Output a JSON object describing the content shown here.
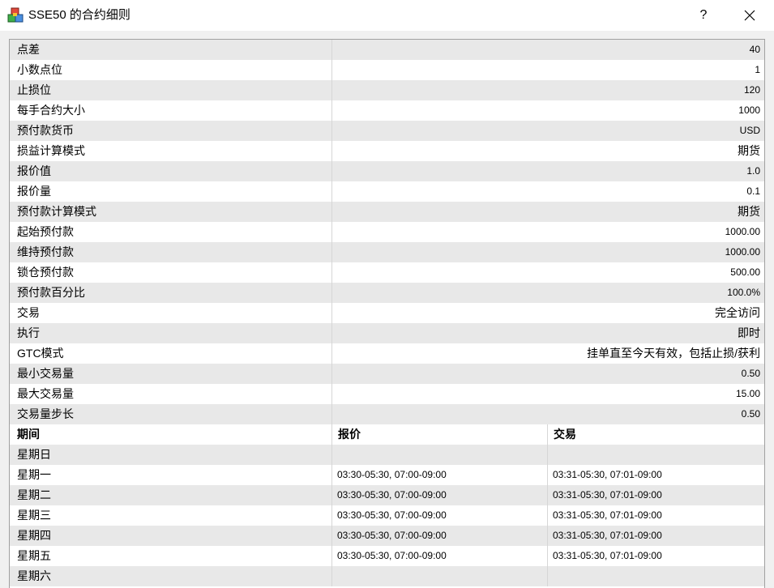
{
  "window": {
    "title": "SSE50 的合约细则",
    "help_label": "?",
    "icons": {
      "app": "app-cubes-icon",
      "close": "close-icon"
    }
  },
  "specs": [
    {
      "label": "点差",
      "value": "40"
    },
    {
      "label": "小数点位",
      "value": "1"
    },
    {
      "label": "止损位",
      "value": "120"
    },
    {
      "label": "每手合约大小",
      "value": "1000"
    },
    {
      "label": "预付款货币",
      "value": "USD"
    },
    {
      "label": "损益计算模式",
      "value": "期货"
    },
    {
      "label": "报价值",
      "value": "1.0"
    },
    {
      "label": "报价量",
      "value": "0.1"
    },
    {
      "label": "预付款计算模式",
      "value": "期货"
    },
    {
      "label": "起始预付款",
      "value": "1000.00"
    },
    {
      "label": "维持预付款",
      "value": "1000.00"
    },
    {
      "label": "锁仓预付款",
      "value": "500.00"
    },
    {
      "label": "预付款百分比",
      "value": "100.0%"
    },
    {
      "label": "交易",
      "value": "完全访问"
    },
    {
      "label": "执行",
      "value": "即时"
    },
    {
      "label": "GTC模式",
      "value": "挂单直至今天有效，包括止损/获利"
    },
    {
      "label": "最小交易量",
      "value": "0.50"
    },
    {
      "label": "最大交易量",
      "value": "15.00"
    },
    {
      "label": "交易量步长",
      "value": "0.50"
    }
  ],
  "sessions": {
    "headers": {
      "period": "期间",
      "quotes": "报价",
      "trades": "交易"
    },
    "days": [
      {
        "day": "星期日",
        "quotes": "",
        "trades": ""
      },
      {
        "day": "星期一",
        "quotes": "03:30-05:30, 07:00-09:00",
        "trades": "03:31-05:30, 07:01-09:00"
      },
      {
        "day": "星期二",
        "quotes": "03:30-05:30, 07:00-09:00",
        "trades": "03:31-05:30, 07:01-09:00"
      },
      {
        "day": "星期三",
        "quotes": "03:30-05:30, 07:00-09:00",
        "trades": "03:31-05:30, 07:01-09:00"
      },
      {
        "day": "星期四",
        "quotes": "03:30-05:30, 07:00-09:00",
        "trades": "03:31-05:30, 07:01-09:00"
      },
      {
        "day": "星期五",
        "quotes": "03:30-05:30, 07:00-09:00",
        "trades": "03:31-05:30, 07:01-09:00"
      },
      {
        "day": "星期六",
        "quotes": "",
        "trades": ""
      }
    ]
  },
  "colors": {
    "title_bar": "#ffffff",
    "dialog_bg": "#f0f0f0",
    "row_alt": "#e8e8e8",
    "row": "#ffffff",
    "grid_border": "#a0a0a0"
  }
}
